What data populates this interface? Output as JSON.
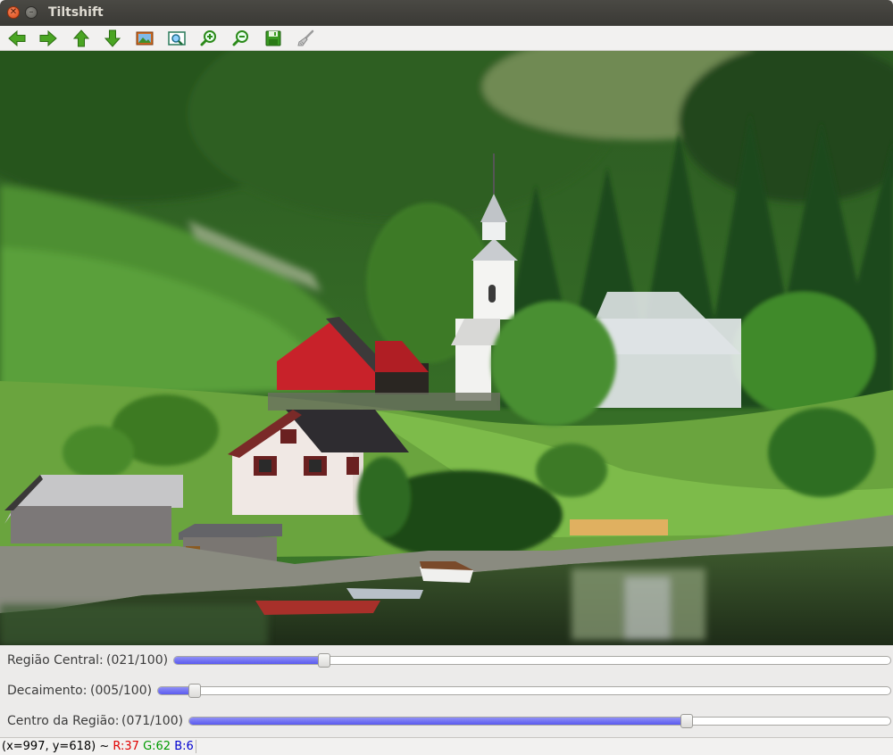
{
  "window": {
    "title": "Tiltshift",
    "close_icon": "close-icon",
    "minimize_icon": "minimize-icon"
  },
  "toolbar": {
    "buttons": [
      {
        "icon": "arrow-left-icon",
        "color": "#3c9a1e"
      },
      {
        "icon": "arrow-right-icon",
        "color": "#3c9a1e"
      },
      {
        "icon": "arrow-up-icon",
        "color": "#3c9a1e"
      },
      {
        "icon": "arrow-down-icon",
        "color": "#3c9a1e"
      },
      {
        "icon": "image-icon",
        "color": "#c8501c"
      },
      {
        "icon": "zoom-fit-icon",
        "color": "#2a9a6a"
      },
      {
        "icon": "zoom-in-icon",
        "color": "#3c9a1e"
      },
      {
        "icon": "zoom-out-icon",
        "color": "#3c9a1e"
      },
      {
        "icon": "save-icon",
        "color": "#2e8a1c"
      },
      {
        "icon": "brush-icon",
        "color": "#9a9a9a"
      }
    ]
  },
  "sliders": [
    {
      "label": "Região Central:",
      "value_text": "(021/100)",
      "value": 21,
      "max": 100
    },
    {
      "label": "Decaimento:",
      "value_text": "(005/100)",
      "value": 5,
      "max": 100
    },
    {
      "label": "Centro da Região:",
      "value_text": "(071/100)",
      "value": 71,
      "max": 100
    }
  ],
  "status": {
    "coords": "(x=997, y=618) ~ ",
    "r": "R:37",
    "g": "G:62",
    "b": "B:6"
  },
  "colors": {
    "slider_fill": "#6a6af2",
    "title_bar": "#3f3e3a"
  }
}
